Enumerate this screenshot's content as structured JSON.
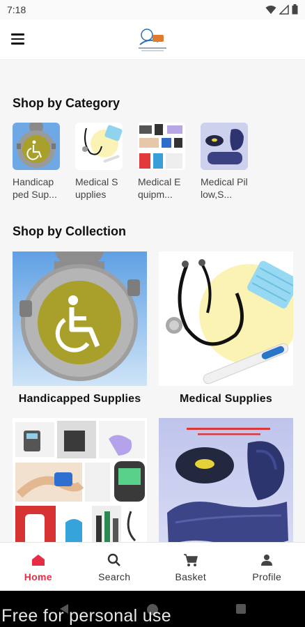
{
  "status_bar": {
    "time": "7:18",
    "icons": [
      "wifi-icon",
      "signal-icon",
      "battery-icon"
    ]
  },
  "app_bar": {
    "menu_icon": "hamburger-menu-icon",
    "logo": "app-logo"
  },
  "categories": {
    "title": "Shop by Category",
    "items": [
      {
        "label": "Handicap ped Sup...",
        "image": "wheelchair-sign"
      },
      {
        "label": "Medical Supplies",
        "image": "stethoscope-mask"
      },
      {
        "label": "Medical Equipm...",
        "image": "medical-devices-collage"
      },
      {
        "label": "Medical Pillow,S...",
        "image": "pillows"
      }
    ]
  },
  "collections": {
    "title": "Shop by Collection",
    "items": [
      {
        "label": "Handicapped Supplies",
        "image": "wheelchair-sign"
      },
      {
        "label": "Medical Supplies",
        "image": "stethoscope-mask"
      },
      {
        "label": "",
        "image": "medical-devices-collage"
      },
      {
        "label": "",
        "image": "pillows"
      }
    ]
  },
  "bottom_nav": {
    "items": [
      {
        "label": "Home",
        "icon": "home-icon",
        "active": true
      },
      {
        "label": "Search",
        "icon": "search-icon",
        "active": false
      },
      {
        "label": "Basket",
        "icon": "cart-icon",
        "active": false
      },
      {
        "label": "Profile",
        "icon": "person-icon",
        "active": false
      }
    ]
  },
  "watermark": "Free for personal use",
  "colors": {
    "accent": "#e52e44",
    "background": "#f6f6f6",
    "wheelchair_olive": "#a8a02a"
  }
}
